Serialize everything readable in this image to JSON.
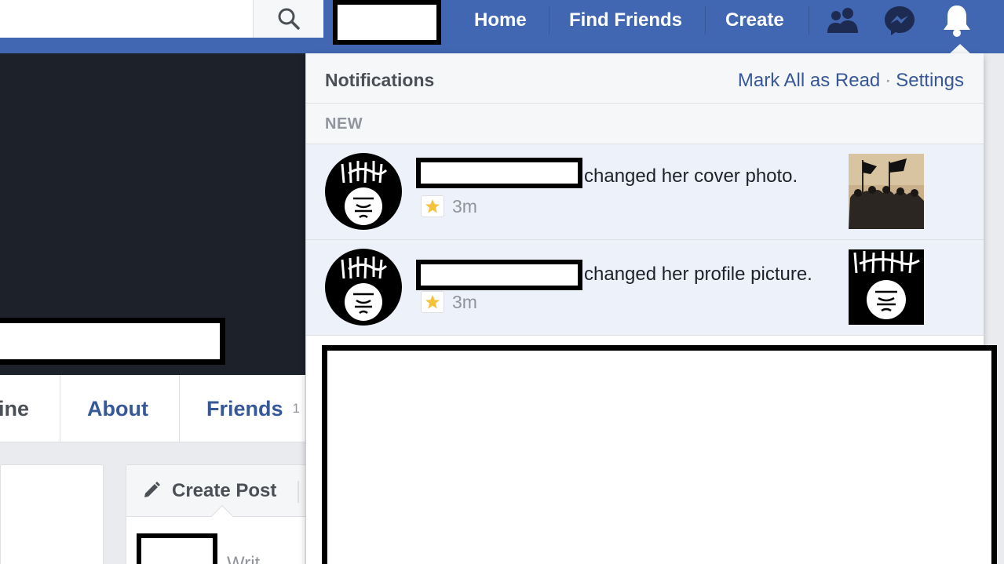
{
  "topbar": {
    "nav": {
      "home": "Home",
      "find_friends": "Find Friends",
      "create": "Create"
    },
    "icons": [
      "friend-requests-icon",
      "messenger-icon",
      "notifications-bell-icon"
    ],
    "colors": {
      "bar": "#4267b2",
      "text": "#ffffff"
    }
  },
  "profile": {
    "tabs": {
      "timeline_partial": "ine",
      "about": "About",
      "friends": "Friends",
      "friends_count_partial": "1"
    },
    "create_post": {
      "label": "Create Post",
      "write_partial": "Writ"
    }
  },
  "notifications": {
    "title": "Notifications",
    "mark_all_read": "Mark All as Read",
    "separator": "·",
    "settings": "Settings",
    "section_label": "NEW",
    "items": [
      {
        "action": "changed her cover photo.",
        "time": "3m",
        "thumbnail": "cover-photo-thumbnail"
      },
      {
        "action": "changed her profile picture.",
        "time": "3m",
        "thumbnail": "profile-picture-thumbnail"
      }
    ]
  }
}
